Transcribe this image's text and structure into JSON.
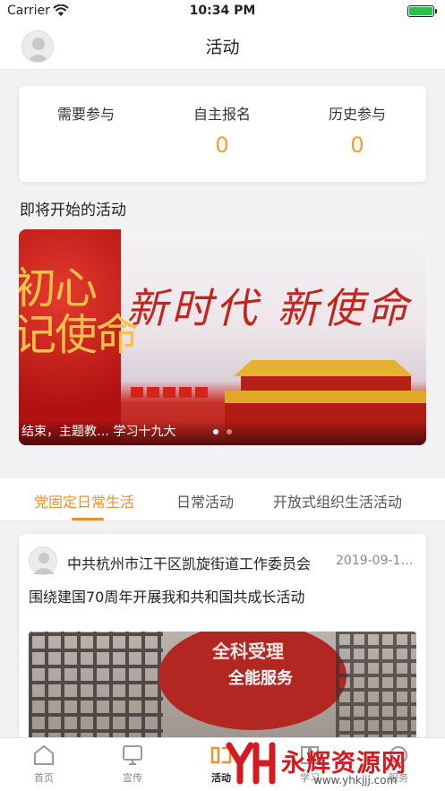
{
  "status_bar": {
    "carrier": "Carrier",
    "time": "10:34 PM"
  },
  "nav": {
    "title": "活动"
  },
  "stats": [
    {
      "label": "需要参与",
      "value": ""
    },
    {
      "label": "自主报名",
      "value": "0"
    },
    {
      "label": "历史参与",
      "value": "0"
    }
  ],
  "upcoming": {
    "section_title": "即将开始的活动",
    "banner": {
      "left_text": "初心\n记使命",
      "slogan": "新时代  新使命",
      "caption": "结束，主题教…  学习十九大"
    }
  },
  "tabs": [
    {
      "label": "党固定日常生活",
      "active": true
    },
    {
      "label": "日常活动",
      "active": false
    },
    {
      "label": "开放式组织生活活动",
      "active": false
    }
  ],
  "activity_card": {
    "org_name": "中共杭州市江干区凯旋街道工作委员会",
    "date": "2019-09-1…",
    "title": "围绕建国70周年开展我和共和国共成长活动",
    "photo_sign_1": "全科受理",
    "photo_sign_2": "全能服务"
  },
  "tab_bar": [
    {
      "label": "首页",
      "icon": "home-icon",
      "active": false
    },
    {
      "label": "宣传",
      "icon": "monitor-icon",
      "active": false
    },
    {
      "label": "活动",
      "icon": "activity-icon",
      "active": true
    },
    {
      "label": "学习",
      "icon": "book-icon",
      "active": false
    },
    {
      "label": "服务",
      "icon": "service-icon",
      "active": false
    }
  ],
  "watermark": {
    "text": "永辉资源网",
    "url": "www.yhkjjj.com"
  },
  "colors": {
    "accent": "#f0902a",
    "stat_value": "#f0a030",
    "battery": "#2bbf4a",
    "watermark": "#d4191f"
  }
}
